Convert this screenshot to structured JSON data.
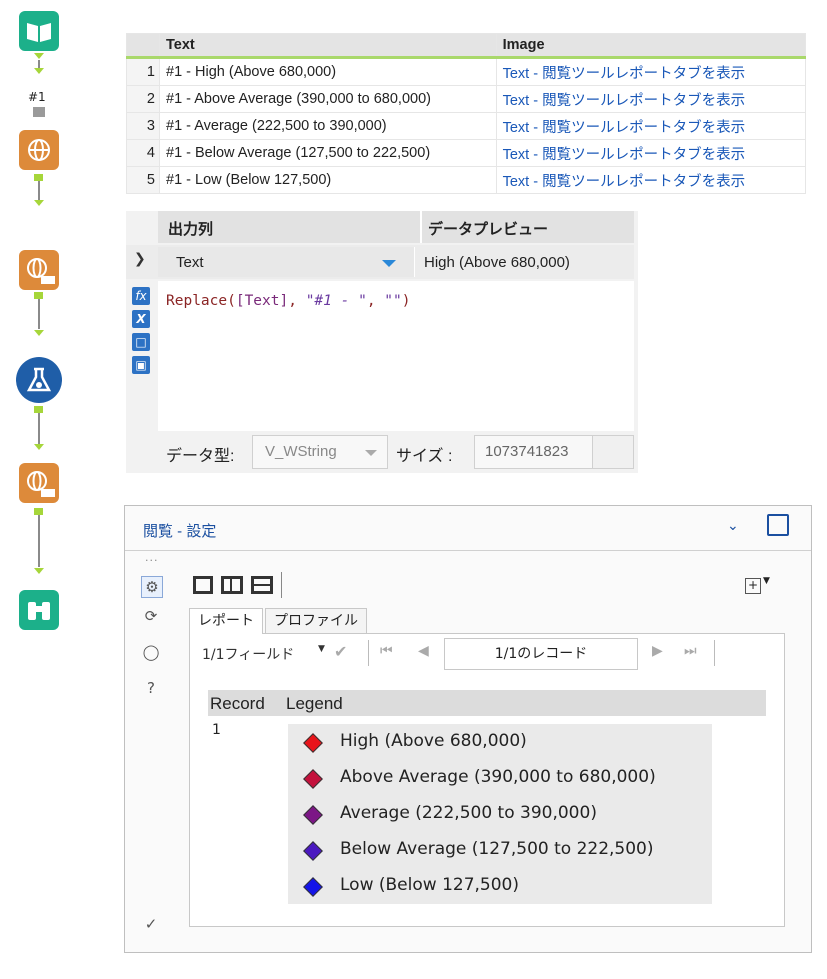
{
  "workflow": {
    "container_label": "#1",
    "tools": [
      "input-book-icon",
      "text-input-globe-icon",
      "transform-globe-icon",
      "formula-flask-icon",
      "output-globe-icon",
      "browse-binoculars-icon"
    ]
  },
  "grid": {
    "headers": [
      "Text",
      "Image"
    ],
    "rows": [
      {
        "n": "1",
        "text": "#1 - High (Above 680,000)",
        "image": "Text - 閲覧ツールレポートタブを表示"
      },
      {
        "n": "2",
        "text": "#1 - Above Average (390,000 to 680,000)",
        "image": "Text - 閲覧ツールレポートタブを表示"
      },
      {
        "n": "3",
        "text": "#1 - Average (222,500 to 390,000)",
        "image": "Text - 閲覧ツールレポートタブを表示"
      },
      {
        "n": "4",
        "text": "#1 - Below Average (127,500 to 222,500)",
        "image": "Text - 閲覧ツールレポートタブを表示"
      },
      {
        "n": "5",
        "text": "#1 - Low (Below 127,500)",
        "image": "Text - 閲覧ツールレポートタブを表示"
      }
    ]
  },
  "formula": {
    "col_output": "出力列",
    "col_preview": "データプレビュー",
    "field": "Text",
    "preview": "High (Above 680,000)",
    "expr_fn": "Replace(",
    "expr_field": "[Text]",
    "expr_sep1": ", ",
    "expr_str1": "\"#1 - \"",
    "expr_sep2": ", ",
    "expr_str2": "\"\"",
    "expr_end": ")",
    "datatype_label": "データ型:",
    "datatype_value": "V_WString",
    "size_label": "サイズ :",
    "size_value": "1073741823",
    "side_icons": [
      "fx",
      "X"
    ]
  },
  "browse": {
    "title": "閲覧 - 設定",
    "tabs": [
      "レポート",
      "プロファイル"
    ],
    "field_count": "1/1フィールド",
    "record_box": "1/1のレコード",
    "col_record": "Record",
    "col_legend": "Legend",
    "record_value": "1",
    "legend": [
      {
        "label": "High (Above 680,000)",
        "color": "#e8141a"
      },
      {
        "label": "Above Average (390,000 to 680,000)",
        "color": "#c4113c"
      },
      {
        "label": "Average (222,500 to 390,000)",
        "color": "#7c1686"
      },
      {
        "label": "Below Average (127,500 to 222,500)",
        "color": "#4a18c0"
      },
      {
        "label": "Low (Below 127,500)",
        "color": "#1414e8"
      }
    ]
  }
}
